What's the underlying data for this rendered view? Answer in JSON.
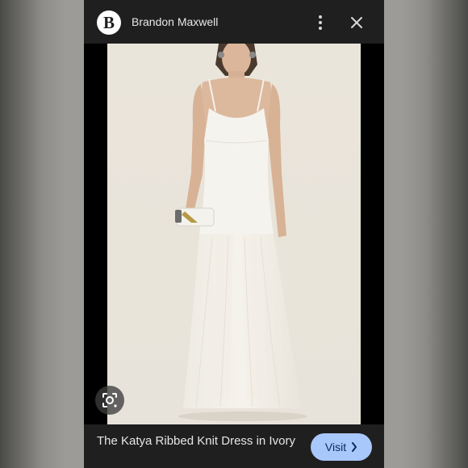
{
  "header": {
    "logo_letter": "B",
    "brand_name": "Brandon Maxwell",
    "more_icon": "more-vert-icon",
    "close_icon": "close-icon"
  },
  "image": {
    "subject": "model-in-ivory-dress",
    "lens_icon": "lens-search-icon"
  },
  "footer": {
    "caption": "The Katya Ribbed Knit Dress in Ivory",
    "visit_label": "Visit",
    "visit_icon": "chevron-right-icon"
  },
  "colors": {
    "panel": "#1f1f1f",
    "visit_button": "#a8c7fa",
    "visit_text": "#0b2a5a",
    "photo_backdrop": "#e9e4da"
  }
}
